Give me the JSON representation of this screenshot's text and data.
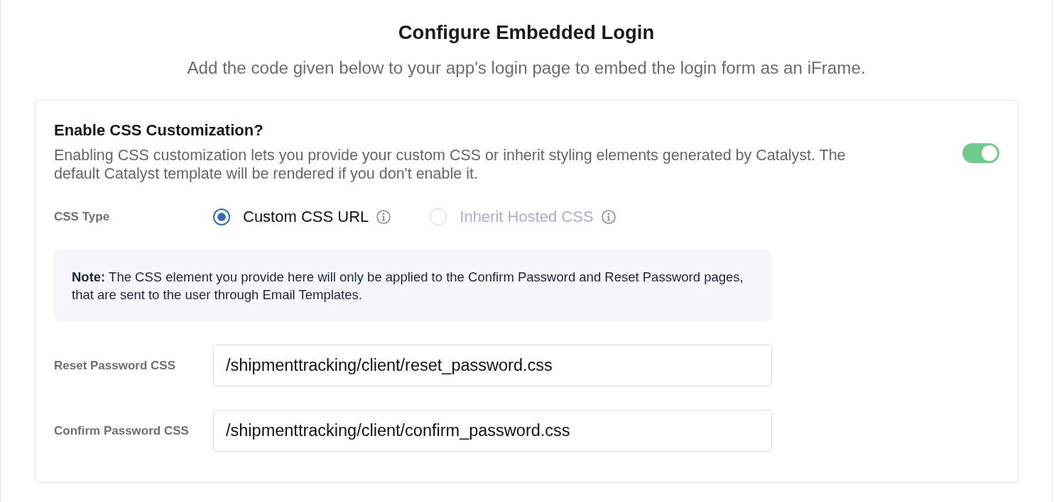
{
  "header": {
    "title": "Configure Embedded Login",
    "subtitle": "Add the code given below to your app's login page to embed the login form as an iFrame."
  },
  "css_customization": {
    "title": "Enable CSS Customization?",
    "description": "Enabling CSS customization lets you provide your custom CSS or inherit styling elements generated by Catalyst. The default Catalyst template will be rendered if you don't enable it.",
    "toggle": {
      "on": true
    },
    "css_type": {
      "label": "CSS Type",
      "options": [
        {
          "label": "Custom CSS URL",
          "selected": true
        },
        {
          "label": "Inherit Hosted CSS",
          "selected": false
        }
      ]
    },
    "note": {
      "text": "**Note:** The CSS element you provide here will only be applied to the Confirm Password and Reset Password pages, that are sent to the user through Email Templates."
    },
    "fields": [
      {
        "label": "Reset Password CSS",
        "value": "/shipmenttracking/client/reset_password.css"
      },
      {
        "label": "Confirm Password CSS",
        "value": "/shipmenttracking/client/confirm_password.css"
      }
    ]
  }
}
